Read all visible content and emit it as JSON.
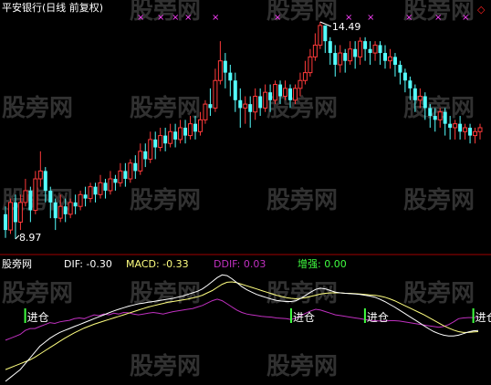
{
  "chart_data": {
    "type": "candlestick",
    "title": "平安银行(日线 前复权)",
    "price_high_label": "14.49",
    "price_low_label": "8.97",
    "x_marker_glyph": "×",
    "diamond_glyph": "◇",
    "watermark_text": "股旁网",
    "candles": [
      [
        9.6,
        9.2,
        9.8,
        9.0
      ],
      [
        9.2,
        9.9,
        10.0,
        9.1
      ],
      [
        9.9,
        9.4,
        10.1,
        8.97
      ],
      [
        9.4,
        9.9,
        10.1,
        9.2
      ],
      [
        9.9,
        10.2,
        10.5,
        9.8
      ],
      [
        10.2,
        9.7,
        10.3,
        9.4
      ],
      [
        9.7,
        10.5,
        10.7,
        9.6
      ],
      [
        10.5,
        10.7,
        11.2,
        10.3
      ],
      [
        10.7,
        10.2,
        10.8,
        9.9
      ],
      [
        10.2,
        9.9,
        10.3,
        9.5
      ],
      [
        9.9,
        9.5,
        10.0,
        9.2
      ],
      [
        9.5,
        9.8,
        10.1,
        9.4
      ],
      [
        9.8,
        9.6,
        10.0,
        9.4
      ],
      [
        9.6,
        9.9,
        10.0,
        9.5
      ],
      [
        9.9,
        9.8,
        10.1,
        9.6
      ],
      [
        9.8,
        10.1,
        10.2,
        9.7
      ],
      [
        10.1,
        10.0,
        10.3,
        9.8
      ],
      [
        10.0,
        10.3,
        10.4,
        9.9
      ],
      [
        10.3,
        10.1,
        10.4,
        9.9
      ],
      [
        10.1,
        10.4,
        10.6,
        10.0
      ],
      [
        10.4,
        10.2,
        10.5,
        10.0
      ],
      [
        10.2,
        10.5,
        10.7,
        10.1
      ],
      [
        10.5,
        10.4,
        10.6,
        10.2
      ],
      [
        10.4,
        10.7,
        10.9,
        10.3
      ],
      [
        10.7,
        10.5,
        10.9,
        10.3
      ],
      [
        10.5,
        10.9,
        11.0,
        10.4
      ],
      [
        10.9,
        10.7,
        11.1,
        10.5
      ],
      [
        10.7,
        11.2,
        11.4,
        10.6
      ],
      [
        11.2,
        11.0,
        11.4,
        10.8
      ],
      [
        11.0,
        11.5,
        11.7,
        10.9
      ],
      [
        11.5,
        11.3,
        11.7,
        11.0
      ],
      [
        11.3,
        11.6,
        11.8,
        11.2
      ],
      [
        11.6,
        11.4,
        11.8,
        11.2
      ],
      [
        11.4,
        11.7,
        11.9,
        11.3
      ],
      [
        11.7,
        11.5,
        11.9,
        11.3
      ],
      [
        11.5,
        11.8,
        12.0,
        11.4
      ],
      [
        11.8,
        11.6,
        12.0,
        11.4
      ],
      [
        11.6,
        11.9,
        12.1,
        11.5
      ],
      [
        11.9,
        11.7,
        12.1,
        11.5
      ],
      [
        11.7,
        12.0,
        12.2,
        11.6
      ],
      [
        12.0,
        12.4,
        12.5,
        11.9
      ],
      [
        12.4,
        12.3,
        12.8,
        12.1
      ],
      [
        12.3,
        13.0,
        13.3,
        12.2
      ],
      [
        13.0,
        13.5,
        14.0,
        12.9
      ],
      [
        13.5,
        13.2,
        13.7,
        12.8
      ],
      [
        13.2,
        13.0,
        13.4,
        12.6
      ],
      [
        13.0,
        12.5,
        13.2,
        12.2
      ],
      [
        12.5,
        12.3,
        12.8,
        11.8
      ],
      [
        12.3,
        12.4,
        12.6,
        11.9
      ],
      [
        12.4,
        12.2,
        12.6,
        11.8
      ],
      [
        12.2,
        12.6,
        12.8,
        12.0
      ],
      [
        12.6,
        12.3,
        12.8,
        12.1
      ],
      [
        12.3,
        12.7,
        12.9,
        12.2
      ],
      [
        12.7,
        12.5,
        12.9,
        12.2
      ],
      [
        12.5,
        12.9,
        13.0,
        12.4
      ],
      [
        12.9,
        12.6,
        13.0,
        12.4
      ],
      [
        12.6,
        12.8,
        13.0,
        12.5
      ],
      [
        12.8,
        12.5,
        12.9,
        12.3
      ],
      [
        12.5,
        12.8,
        12.9,
        12.4
      ],
      [
        12.8,
        13.0,
        13.2,
        12.6
      ],
      [
        13.0,
        13.2,
        13.5,
        12.9
      ],
      [
        13.2,
        13.6,
        13.8,
        13.1
      ],
      [
        13.6,
        13.9,
        14.2,
        13.5
      ],
      [
        13.9,
        14.4,
        14.49,
        13.8
      ],
      [
        14.4,
        14.0,
        14.4,
        13.7
      ],
      [
        14.0,
        13.7,
        14.1,
        13.4
      ],
      [
        13.7,
        13.4,
        13.9,
        13.1
      ],
      [
        13.4,
        13.7,
        13.9,
        13.2
      ],
      [
        13.7,
        13.5,
        13.8,
        13.2
      ],
      [
        13.5,
        13.8,
        14.0,
        13.4
      ],
      [
        13.8,
        13.6,
        14.0,
        13.3
      ],
      [
        13.6,
        14.0,
        14.1,
        13.4
      ],
      [
        14.0,
        13.8,
        14.1,
        13.5
      ],
      [
        13.8,
        13.7,
        14.0,
        13.4
      ],
      [
        13.7,
        13.9,
        14.0,
        13.5
      ],
      [
        13.9,
        13.7,
        14.0,
        13.4
      ],
      [
        13.7,
        13.5,
        13.9,
        13.3
      ],
      [
        13.5,
        13.6,
        13.8,
        13.3
      ],
      [
        13.6,
        13.4,
        13.7,
        13.1
      ],
      [
        13.4,
        13.2,
        13.5,
        12.9
      ],
      [
        13.2,
        13.0,
        13.3,
        12.7
      ],
      [
        13.0,
        12.8,
        13.1,
        12.5
      ],
      [
        12.8,
        12.5,
        12.9,
        12.2
      ],
      [
        12.5,
        12.6,
        12.8,
        12.3
      ],
      [
        12.6,
        12.3,
        12.7,
        12.0
      ],
      [
        12.3,
        12.1,
        12.4,
        11.8
      ],
      [
        12.1,
        12.0,
        12.3,
        11.7
      ],
      [
        12.0,
        12.2,
        12.3,
        11.8
      ],
      [
        12.2,
        11.9,
        12.3,
        11.6
      ],
      [
        11.9,
        11.8,
        12.1,
        11.5
      ],
      [
        11.8,
        11.9,
        12.0,
        11.5
      ],
      [
        11.9,
        11.7,
        12.1,
        11.5
      ],
      [
        11.7,
        11.8,
        11.9,
        11.5
      ],
      [
        11.8,
        11.6,
        11.9,
        11.4
      ],
      [
        11.6,
        11.7,
        11.8,
        11.4
      ],
      [
        11.7,
        11.8,
        11.9,
        11.5
      ]
    ],
    "indicator": {
      "name": "股旁网",
      "labels": [
        "DIF: -0.30",
        "MACD: -0.33",
        "DDIF: 0.03",
        "增强: 0.00"
      ],
      "colors": [
        "#ffffff",
        "#ffff80",
        "#c030c0",
        "#40ff40"
      ],
      "dif": [
        -1.6,
        -1.5,
        -1.4,
        -1.3,
        -1.15,
        -1.0,
        -0.85,
        -0.7,
        -0.6,
        -0.5,
        -0.42,
        -0.35,
        -0.3,
        -0.25,
        -0.2,
        -0.15,
        -0.1,
        -0.05,
        0.0,
        0.05,
        0.1,
        0.15,
        0.2,
        0.24,
        0.28,
        0.32,
        0.35,
        0.38,
        0.4,
        0.42,
        0.44,
        0.46,
        0.48,
        0.5,
        0.52,
        0.55,
        0.58,
        0.62,
        0.66,
        0.7,
        0.76,
        0.85,
        0.95,
        1.05,
        1.12,
        1.1,
        1.02,
        0.92,
        0.82,
        0.74,
        0.68,
        0.62,
        0.58,
        0.54,
        0.5,
        0.47,
        0.45,
        0.44,
        0.44,
        0.46,
        0.52,
        0.6,
        0.68,
        0.75,
        0.78,
        0.76,
        0.72,
        0.68,
        0.66,
        0.65,
        0.64,
        0.63,
        0.62,
        0.6,
        0.58,
        0.55,
        0.5,
        0.44,
        0.37,
        0.3,
        0.22,
        0.14,
        0.06,
        -0.02,
        -0.1,
        -0.18,
        -0.26,
        -0.33,
        -0.38,
        -0.42,
        -0.44,
        -0.44,
        -0.42,
        -0.38,
        -0.34,
        -0.31,
        -0.3
      ],
      "macd": [
        -1.3,
        -1.25,
        -1.2,
        -1.15,
        -1.1,
        -1.05,
        -0.98,
        -0.9,
        -0.82,
        -0.74,
        -0.66,
        -0.58,
        -0.5,
        -0.43,
        -0.36,
        -0.3,
        -0.24,
        -0.19,
        -0.14,
        -0.1,
        -0.06,
        -0.02,
        0.02,
        0.06,
        0.1,
        0.14,
        0.18,
        0.22,
        0.26,
        0.3,
        0.33,
        0.36,
        0.39,
        0.42,
        0.44,
        0.46,
        0.48,
        0.5,
        0.53,
        0.56,
        0.6,
        0.66,
        0.72,
        0.8,
        0.88,
        0.93,
        0.94,
        0.92,
        0.88,
        0.84,
        0.8,
        0.76,
        0.72,
        0.68,
        0.64,
        0.6,
        0.57,
        0.54,
        0.52,
        0.51,
        0.52,
        0.54,
        0.57,
        0.6,
        0.63,
        0.65,
        0.66,
        0.66,
        0.66,
        0.65,
        0.65,
        0.64,
        0.63,
        0.62,
        0.61,
        0.6,
        0.58,
        0.55,
        0.51,
        0.46,
        0.4,
        0.34,
        0.28,
        0.22,
        0.16,
        0.1,
        0.03,
        -0.04,
        -0.11,
        -0.18,
        -0.24,
        -0.29,
        -0.33,
        -0.35,
        -0.35,
        -0.34,
        -0.33
      ],
      "ddif": [
        -0.55,
        -0.5,
        -0.45,
        -0.4,
        -0.3,
        -0.25,
        -0.25,
        -0.2,
        -0.15,
        -0.1,
        -0.12,
        -0.08,
        -0.06,
        -0.04,
        0.0,
        0.02,
        0.0,
        0.05,
        0.1,
        0.08,
        0.12,
        0.1,
        0.14,
        0.12,
        0.16,
        0.15,
        0.12,
        0.1,
        0.12,
        0.14,
        0.16,
        0.14,
        0.12,
        0.15,
        0.18,
        0.2,
        0.22,
        0.24,
        0.26,
        0.3,
        0.34,
        0.4,
        0.46,
        0.5,
        0.46,
        0.38,
        0.3,
        0.22,
        0.16,
        0.12,
        0.1,
        0.08,
        0.06,
        0.05,
        0.04,
        0.02,
        0.01,
        0.0,
        -0.02,
        0.02,
        0.08,
        0.14,
        0.2,
        0.24,
        0.22,
        0.18,
        0.14,
        0.1,
        0.08,
        0.06,
        0.04,
        0.02,
        0.0,
        -0.02,
        -0.04,
        -0.05,
        -0.06,
        -0.06,
        -0.05,
        -0.05,
        -0.06,
        -0.08,
        -0.1,
        -0.12,
        -0.14,
        -0.16,
        -0.18,
        -0.2,
        -0.22,
        -0.2,
        -0.15,
        -0.08,
        0.0,
        0.02,
        0.03,
        0.03,
        0.03
      ],
      "signal_label": "进仓",
      "signal_indices": [
        4,
        58,
        73,
        95
      ]
    }
  }
}
